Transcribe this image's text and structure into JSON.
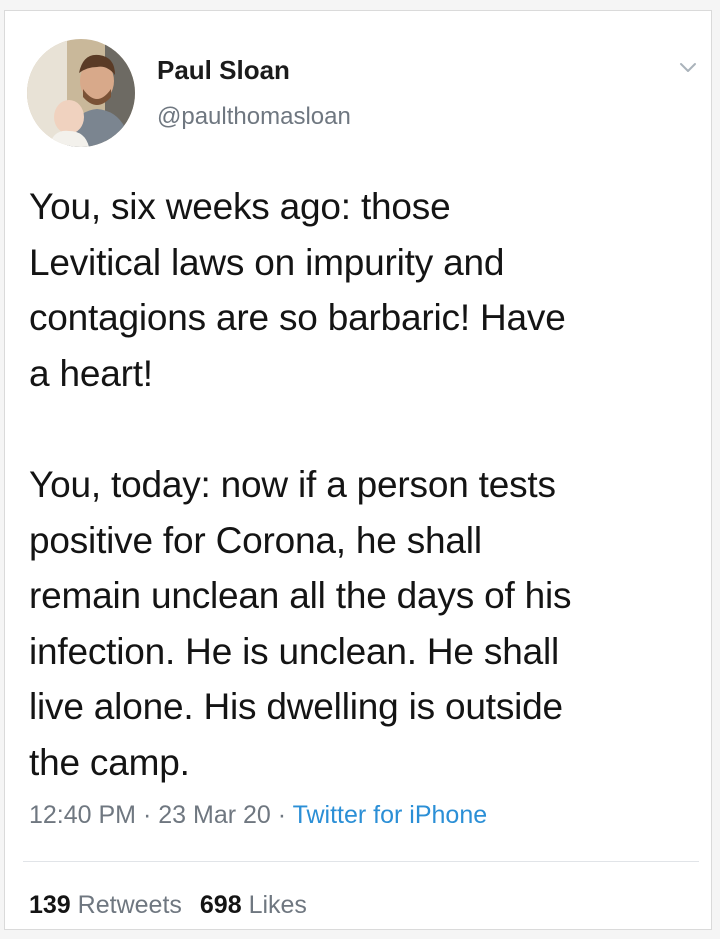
{
  "user": {
    "name": "Paul Sloan",
    "handle": "@paulthomasloan"
  },
  "icons": {
    "menu": "chevron-down-icon"
  },
  "tweet": {
    "paragraphs": [
      "You, six weeks ago: those\nLevitical laws on impurity and\ncontagions are so barbaric! Have\na heart!",
      "You, today: now if a person tests\npositive for Corona, he shall\nremain unclean all the days of his\ninfection. He is unclean. He shall\nlive alone. His dwelling is outside\nthe camp."
    ],
    "time": "12:40 PM",
    "date": "23 Mar 20",
    "source": "Twitter for iPhone",
    "separator": "·"
  },
  "stats": {
    "retweets_count": "139",
    "retweets_label": "Retweets",
    "likes_count": "698",
    "likes_label": "Likes"
  },
  "colors": {
    "link": "#2b8fd6",
    "muted": "#6f7780",
    "text": "#141414"
  }
}
